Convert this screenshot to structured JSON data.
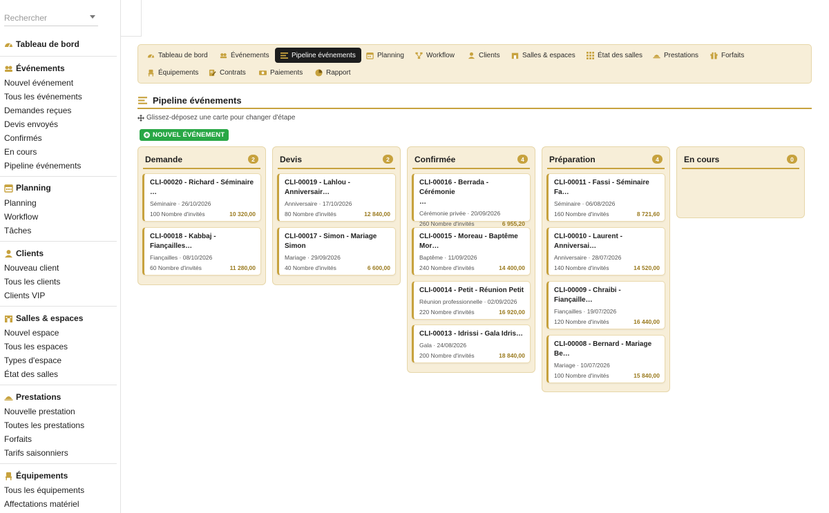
{
  "search": {
    "placeholder": "Rechercher"
  },
  "sidebar": {
    "dashboard": "Tableau de bord",
    "sections": [
      {
        "title": "Événements",
        "icon": "event-icon",
        "items": [
          "Nouvel événement",
          "Tous les événements",
          "Demandes reçues",
          "Devis envoyés",
          "Confirmés",
          "En cours",
          "Pipeline événements"
        ]
      },
      {
        "title": "Planning",
        "icon": "calendar-icon",
        "items": [
          "Planning",
          "Workflow",
          "Tâches"
        ]
      },
      {
        "title": "Clients",
        "icon": "user-icon",
        "items": [
          "Nouveau client",
          "Tous les clients",
          "Clients VIP"
        ]
      },
      {
        "title": "Salles & espaces",
        "icon": "building-icon",
        "items": [
          "Nouvel espace",
          "Tous les espaces",
          "Types d'espace",
          "État des salles"
        ]
      },
      {
        "title": "Prestations",
        "icon": "service-icon",
        "items": [
          "Nouvelle prestation",
          "Toutes les prestations",
          "Forfaits",
          "Tarifs saisonniers"
        ]
      },
      {
        "title": "Équipements",
        "icon": "chair-icon",
        "items": [
          "Tous les équipements",
          "Affectations matériel"
        ]
      }
    ]
  },
  "tabs": [
    {
      "label": "Tableau de bord",
      "icon": "dashboard-icon"
    },
    {
      "label": "Événements",
      "icon": "event-icon"
    },
    {
      "label": "Pipeline événements",
      "icon": "pipeline-icon",
      "active": true
    },
    {
      "label": "Planning",
      "icon": "calendar-icon"
    },
    {
      "label": "Workflow",
      "icon": "workflow-icon"
    },
    {
      "label": "Clients",
      "icon": "user-icon"
    },
    {
      "label": "Salles & espaces",
      "icon": "building-icon"
    },
    {
      "label": "État des salles",
      "icon": "grid-icon"
    },
    {
      "label": "Prestations",
      "icon": "service-icon"
    },
    {
      "label": "Forfaits",
      "icon": "gift-icon"
    },
    {
      "label": "Équipements",
      "icon": "chair-icon"
    },
    {
      "label": "Contrats",
      "icon": "contract-icon"
    },
    {
      "label": "Paiements",
      "icon": "money-icon"
    },
    {
      "label": "Rapport",
      "icon": "report-icon"
    }
  ],
  "page": {
    "title": "Pipeline événements",
    "hint": "Glissez-déposez une carte pour changer d'étape",
    "new_button": "NOUVEL ÉVÉNEMENT"
  },
  "columns": [
    {
      "title": "Demande",
      "count": "2",
      "cards": [
        {
          "title_l1": "CLI-00020 - Richard - Séminaire",
          "title_l2": "…",
          "type": "Séminaire",
          "date": "26/10/2026",
          "guests": "100 Nombre d'invités",
          "amount": "10 320,00"
        },
        {
          "title_l1": "CLI-00018 - Kabbaj -",
          "title_l2": "Fiançailles…",
          "type": "Fiançailles",
          "date": "08/10/2026",
          "guests": "60 Nombre d'invités",
          "amount": "11 280,00"
        }
      ]
    },
    {
      "title": "Devis",
      "count": "2",
      "cards": [
        {
          "title_l1": "CLI-00019 - Lahlou -",
          "title_l2": "Anniversair…",
          "type": "Anniversaire",
          "date": "17/10/2026",
          "guests": "80 Nombre d'invités",
          "amount": "12 840,00"
        },
        {
          "title_l1": "CLI-00017 - Simon - Mariage",
          "title_l2": "Simon",
          "type": "Mariage",
          "date": "29/09/2026",
          "guests": "40 Nombre d'invités",
          "amount": "6 600,00"
        }
      ]
    },
    {
      "title": "Confirmée",
      "count": "4",
      "cards": [
        {
          "title_l1": "CLI-00016 - Berrada - Cérémonie",
          "title_l2": "…",
          "type": "Cérémonie privée",
          "date": "20/09/2026",
          "guests": "260 Nombre d'invités",
          "amount": "6 955,20"
        },
        {
          "title_l1": "CLI-00015 - Moreau - Baptême",
          "title_l2": "Mor…",
          "type": "Baptême",
          "date": "11/09/2026",
          "guests": "240 Nombre d'invités",
          "amount": "14 400,00"
        },
        {
          "title_l1": "CLI-00014 - Petit - Réunion Petit",
          "title_l2": "",
          "type": "Réunion professionnelle",
          "date": "02/09/2026",
          "guests": "220 Nombre d'invités",
          "amount": "16 920,00"
        },
        {
          "title_l1": "CLI-00013 - Idrissi - Gala Idris…",
          "title_l2": "",
          "type": "Gala",
          "date": "24/08/2026",
          "guests": "200 Nombre d'invités",
          "amount": "18 840,00"
        }
      ]
    },
    {
      "title": "Préparation",
      "count": "4",
      "cards": [
        {
          "title_l1": "CLI-00011 - Fassi - Séminaire",
          "title_l2": "Fa…",
          "type": "Séminaire",
          "date": "06/08/2026",
          "guests": "160 Nombre d'invités",
          "amount": "8 721,60"
        },
        {
          "title_l1": "CLI-00010 - Laurent -",
          "title_l2": "Anniversai…",
          "type": "Anniversaire",
          "date": "28/07/2026",
          "guests": "140 Nombre d'invités",
          "amount": "14 520,00"
        },
        {
          "title_l1": "CLI-00009 - Chraibi -",
          "title_l2": "Fiançaille…",
          "type": "Fiançailles",
          "date": "19/07/2026",
          "guests": "120 Nombre d'invités",
          "amount": "16 440,00"
        },
        {
          "title_l1": "CLI-00008 - Bernard - Mariage",
          "title_l2": "Be…",
          "type": "Mariage",
          "date": "10/07/2026",
          "guests": "100 Nombre d'invités",
          "amount": "15 840,00"
        }
      ]
    },
    {
      "title": "En cours",
      "count": "0",
      "cards": []
    }
  ],
  "colors": {
    "accent": "#c7a23e",
    "panel": "#f7eed8",
    "success": "#28a745",
    "active_tab": "#1d1d1d"
  }
}
